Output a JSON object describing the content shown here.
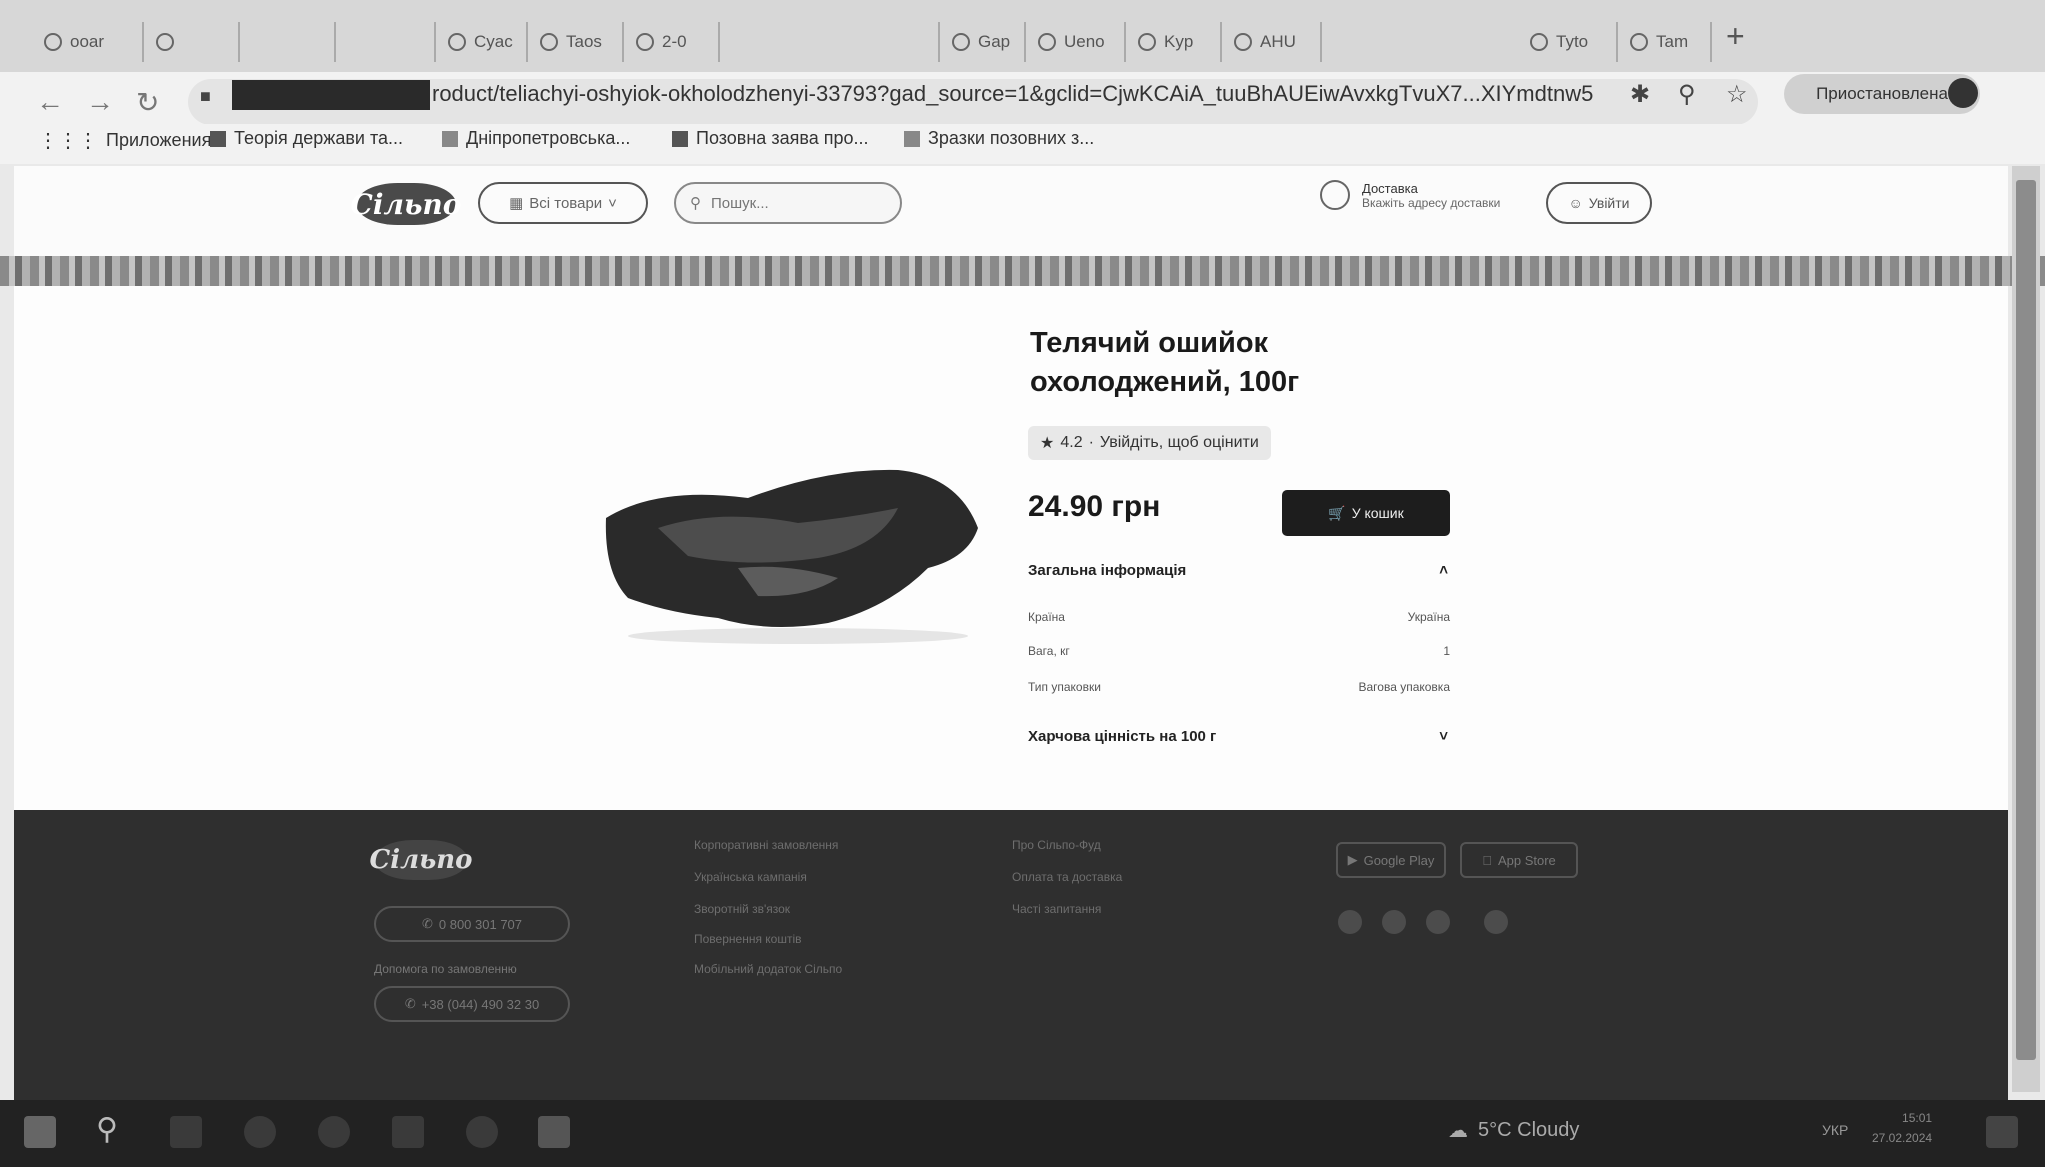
{
  "browser": {
    "tabs": [
      {
        "label": "ooar"
      },
      {
        "label": ""
      },
      {
        "label": ""
      },
      {
        "label": ""
      },
      {
        "label": "Cyac"
      },
      {
        "label": "Taos"
      },
      {
        "label": "2-0"
      },
      {
        "label": ""
      },
      {
        "label": "Gap"
      },
      {
        "label": "Ueno"
      },
      {
        "label": "Kyp"
      },
      {
        "label": "AHU"
      },
      {
        "label": "Tyto"
      },
      {
        "label": "Tam"
      }
    ],
    "new_tab_label": "+",
    "url": "roduct/teliachyi-oshyiok-okholodzhenyi-33793?gad_source=1&gclid=CjwKCAiA_tuuBhAUEiwAvxkgTvuX7...XIYmdtnw5",
    "paused_label": "Приостановлена",
    "bookmarks": [
      {
        "label": "Приложения",
        "icon": "apps-grid-icon"
      },
      {
        "label": "Теорія держави та...",
        "icon": "bookmark-icon"
      },
      {
        "label": "Дніпропетровська...",
        "icon": "bookmark-icon"
      },
      {
        "label": "Позовна заява про...",
        "icon": "bookmark-icon"
      },
      {
        "label": "Зразки позовних з...",
        "icon": "bookmark-icon"
      }
    ]
  },
  "site_header": {
    "logo": "Сільпо",
    "catalog_label": "Всі товари",
    "search_placeholder": "Пошук...",
    "delivery_title": "Доставка",
    "delivery_subtitle": "Вкажіть адресу доставки",
    "login_label": "Увійти"
  },
  "product": {
    "title_line1": "Телячий ошийок",
    "title_line2": "охолоджений, 100г",
    "rating_value": "4.2",
    "rating_action": "Увійдіть, щоб оцінити",
    "price": "24.90 грн",
    "cart_label": "У кошик",
    "general_info_title": "Загальна інформація",
    "info_rows": [
      {
        "label": "Країна",
        "value": "Україна"
      },
      {
        "label": "Вага, кг",
        "value": "1"
      },
      {
        "label": "Тип упаковки",
        "value": "Вагова упаковка"
      }
    ],
    "nutrition_title": "Харчова цінність на 100 г"
  },
  "footer": {
    "logo": "Сільпо",
    "hotline": "0 800 301 707",
    "support_label": "Допомога по замовленню",
    "support_phone": "+38 (044) 490 32 30",
    "links_col1": [
      "Корпоративні замовлення",
      "Українська кампанія",
      "Зворотній зв'язок",
      "Повернення коштів",
      "Мобільний додаток Сільпо"
    ],
    "links_col2": [
      "Про Сільпо-Фуд",
      "Оплата та доставка",
      "Часті запитання"
    ],
    "google_play": "Google Play",
    "app_store": "App Store"
  },
  "taskbar": {
    "weather": "5°C  Cloudy",
    "lang": "УКР",
    "time": "15:01",
    "date": "27.02.2024"
  }
}
